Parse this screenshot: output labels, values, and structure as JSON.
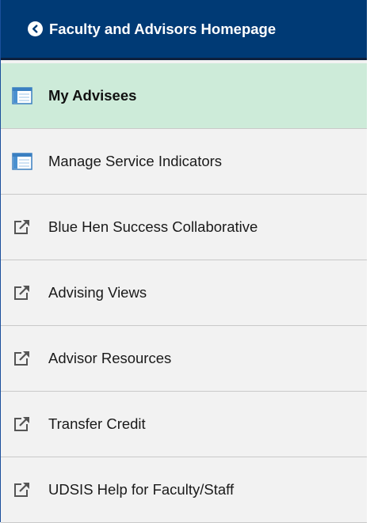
{
  "header": {
    "back_icon": "chevron-left-circle-icon",
    "title": "Faculty and Advisors Homepage"
  },
  "menu": {
    "items": [
      {
        "label": "My Advisees",
        "icon": "component-page-icon",
        "selected": true
      },
      {
        "label": "Manage Service Indicators",
        "icon": "component-page-icon",
        "selected": false
      },
      {
        "label": "Blue Hen Success Collaborative",
        "icon": "external-link-icon",
        "selected": false
      },
      {
        "label": "Advising Views",
        "icon": "external-link-icon",
        "selected": false
      },
      {
        "label": "Advisor Resources",
        "icon": "external-link-icon",
        "selected": false
      },
      {
        "label": "Transfer Credit",
        "icon": "external-link-icon",
        "selected": false
      },
      {
        "label": "UDSIS Help for Faculty/Staff",
        "icon": "external-link-icon",
        "selected": false
      }
    ]
  },
  "colors": {
    "header_bg": "#003a75",
    "selected_bg": "#cdebd9",
    "panel_bg": "#f2f2f2"
  }
}
